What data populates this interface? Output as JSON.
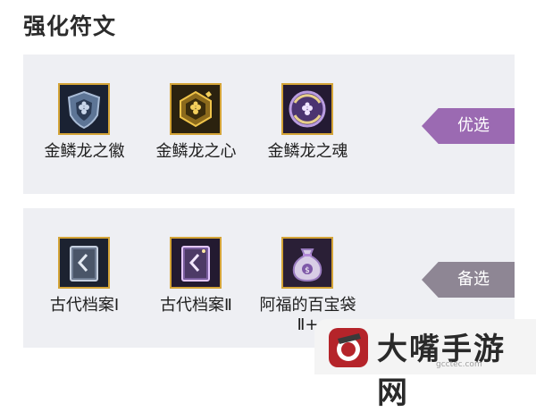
{
  "header": {
    "title": "强化符文"
  },
  "preferred": {
    "tag": "优选",
    "items": [
      {
        "label": "金鳞龙之徽",
        "icon": "dragon-shield-icon"
      },
      {
        "label": "金鳞龙之心",
        "icon": "dragon-heart-icon"
      },
      {
        "label": "金鳞龙之魂",
        "icon": "dragon-soul-icon"
      }
    ]
  },
  "alternative": {
    "tag": "备选",
    "items": [
      {
        "label": "古代档案Ⅰ",
        "icon": "ancient-tome-icon"
      },
      {
        "label": "古代档案Ⅱ",
        "icon": "ancient-tome-rare-icon"
      },
      {
        "label": "阿福的百宝袋Ⅱ+",
        "icon": "treasure-bag-icon"
      }
    ]
  },
  "watermark": {
    "brand": "大嘴手游网",
    "url": "gcctec.com"
  },
  "colors": {
    "gold_border": "#d4a437",
    "preferred_tag": "#9b6ab2",
    "alt_tag": "#8e8694",
    "panel": "#eeeff3"
  }
}
